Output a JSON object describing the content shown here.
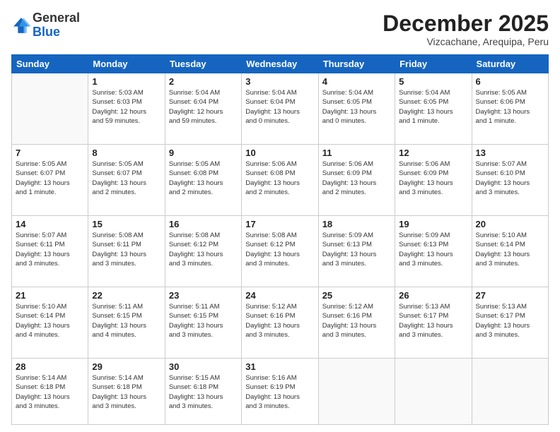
{
  "header": {
    "logo_general": "General",
    "logo_blue": "Blue",
    "month_title": "December 2025",
    "location": "Vizcachane, Arequipa, Peru"
  },
  "weekdays": [
    "Sunday",
    "Monday",
    "Tuesday",
    "Wednesday",
    "Thursday",
    "Friday",
    "Saturday"
  ],
  "weeks": [
    [
      {
        "day": "",
        "info": ""
      },
      {
        "day": "1",
        "info": "Sunrise: 5:03 AM\nSunset: 6:03 PM\nDaylight: 12 hours\nand 59 minutes."
      },
      {
        "day": "2",
        "info": "Sunrise: 5:04 AM\nSunset: 6:04 PM\nDaylight: 12 hours\nand 59 minutes."
      },
      {
        "day": "3",
        "info": "Sunrise: 5:04 AM\nSunset: 6:04 PM\nDaylight: 13 hours\nand 0 minutes."
      },
      {
        "day": "4",
        "info": "Sunrise: 5:04 AM\nSunset: 6:05 PM\nDaylight: 13 hours\nand 0 minutes."
      },
      {
        "day": "5",
        "info": "Sunrise: 5:04 AM\nSunset: 6:05 PM\nDaylight: 13 hours\nand 1 minute."
      },
      {
        "day": "6",
        "info": "Sunrise: 5:05 AM\nSunset: 6:06 PM\nDaylight: 13 hours\nand 1 minute."
      }
    ],
    [
      {
        "day": "7",
        "info": "Sunrise: 5:05 AM\nSunset: 6:07 PM\nDaylight: 13 hours\nand 1 minute."
      },
      {
        "day": "8",
        "info": "Sunrise: 5:05 AM\nSunset: 6:07 PM\nDaylight: 13 hours\nand 2 minutes."
      },
      {
        "day": "9",
        "info": "Sunrise: 5:05 AM\nSunset: 6:08 PM\nDaylight: 13 hours\nand 2 minutes."
      },
      {
        "day": "10",
        "info": "Sunrise: 5:06 AM\nSunset: 6:08 PM\nDaylight: 13 hours\nand 2 minutes."
      },
      {
        "day": "11",
        "info": "Sunrise: 5:06 AM\nSunset: 6:09 PM\nDaylight: 13 hours\nand 2 minutes."
      },
      {
        "day": "12",
        "info": "Sunrise: 5:06 AM\nSunset: 6:09 PM\nDaylight: 13 hours\nand 3 minutes."
      },
      {
        "day": "13",
        "info": "Sunrise: 5:07 AM\nSunset: 6:10 PM\nDaylight: 13 hours\nand 3 minutes."
      }
    ],
    [
      {
        "day": "14",
        "info": "Sunrise: 5:07 AM\nSunset: 6:11 PM\nDaylight: 13 hours\nand 3 minutes."
      },
      {
        "day": "15",
        "info": "Sunrise: 5:08 AM\nSunset: 6:11 PM\nDaylight: 13 hours\nand 3 minutes."
      },
      {
        "day": "16",
        "info": "Sunrise: 5:08 AM\nSunset: 6:12 PM\nDaylight: 13 hours\nand 3 minutes."
      },
      {
        "day": "17",
        "info": "Sunrise: 5:08 AM\nSunset: 6:12 PM\nDaylight: 13 hours\nand 3 minutes."
      },
      {
        "day": "18",
        "info": "Sunrise: 5:09 AM\nSunset: 6:13 PM\nDaylight: 13 hours\nand 3 minutes."
      },
      {
        "day": "19",
        "info": "Sunrise: 5:09 AM\nSunset: 6:13 PM\nDaylight: 13 hours\nand 3 minutes."
      },
      {
        "day": "20",
        "info": "Sunrise: 5:10 AM\nSunset: 6:14 PM\nDaylight: 13 hours\nand 3 minutes."
      }
    ],
    [
      {
        "day": "21",
        "info": "Sunrise: 5:10 AM\nSunset: 6:14 PM\nDaylight: 13 hours\nand 4 minutes."
      },
      {
        "day": "22",
        "info": "Sunrise: 5:11 AM\nSunset: 6:15 PM\nDaylight: 13 hours\nand 4 minutes."
      },
      {
        "day": "23",
        "info": "Sunrise: 5:11 AM\nSunset: 6:15 PM\nDaylight: 13 hours\nand 3 minutes."
      },
      {
        "day": "24",
        "info": "Sunrise: 5:12 AM\nSunset: 6:16 PM\nDaylight: 13 hours\nand 3 minutes."
      },
      {
        "day": "25",
        "info": "Sunrise: 5:12 AM\nSunset: 6:16 PM\nDaylight: 13 hours\nand 3 minutes."
      },
      {
        "day": "26",
        "info": "Sunrise: 5:13 AM\nSunset: 6:17 PM\nDaylight: 13 hours\nand 3 minutes."
      },
      {
        "day": "27",
        "info": "Sunrise: 5:13 AM\nSunset: 6:17 PM\nDaylight: 13 hours\nand 3 minutes."
      }
    ],
    [
      {
        "day": "28",
        "info": "Sunrise: 5:14 AM\nSunset: 6:18 PM\nDaylight: 13 hours\nand 3 minutes."
      },
      {
        "day": "29",
        "info": "Sunrise: 5:14 AM\nSunset: 6:18 PM\nDaylight: 13 hours\nand 3 minutes."
      },
      {
        "day": "30",
        "info": "Sunrise: 5:15 AM\nSunset: 6:18 PM\nDaylight: 13 hours\nand 3 minutes."
      },
      {
        "day": "31",
        "info": "Sunrise: 5:16 AM\nSunset: 6:19 PM\nDaylight: 13 hours\nand 3 minutes."
      },
      {
        "day": "",
        "info": ""
      },
      {
        "day": "",
        "info": ""
      },
      {
        "day": "",
        "info": ""
      }
    ]
  ]
}
